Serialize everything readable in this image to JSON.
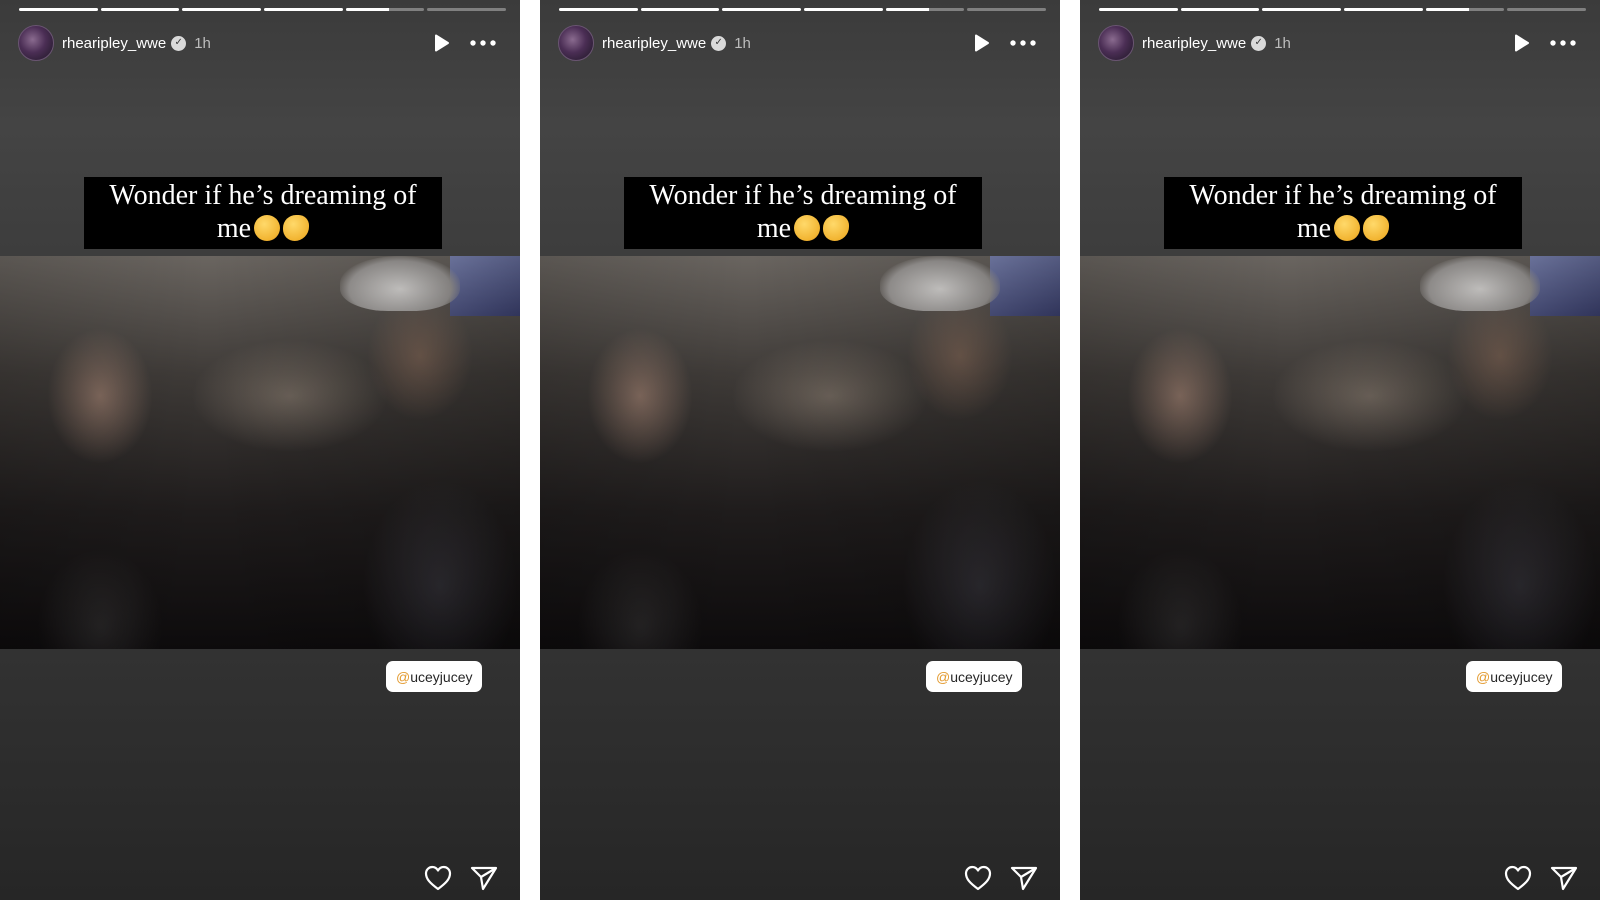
{
  "stories": [
    {
      "progress": [
        1,
        1,
        1,
        1,
        0.55,
        0
      ],
      "username": "rhearipley_wwe",
      "verified_glyph": "✓",
      "time": "1h",
      "caption_line1": "Wonder if he’s dreaming of",
      "caption_line2": "me",
      "mention_prefix": "@",
      "mention_name": "uceyjucey",
      "icons": [
        "play-icon",
        "more-icon",
        "heart-icon",
        "send-icon"
      ]
    },
    {
      "progress": [
        1,
        1,
        1,
        1,
        0.55,
        0
      ],
      "username": "rhearipley_wwe",
      "verified_glyph": "✓",
      "time": "1h",
      "caption_line1": "Wonder if he’s dreaming of",
      "caption_line2": "me",
      "mention_prefix": "@",
      "mention_name": "uceyjucey",
      "icons": [
        "play-icon",
        "more-icon",
        "heart-icon",
        "send-icon"
      ]
    },
    {
      "progress": [
        1,
        1,
        1,
        1,
        0.55,
        0
      ],
      "username": "rhearipley_wwe",
      "verified_glyph": "✓",
      "time": "1h",
      "caption_line1": "Wonder if he’s dreaming of",
      "caption_line2": "me",
      "mention_prefix": "@",
      "mention_name": "uceyjucey",
      "icons": [
        "play-icon",
        "more-icon",
        "heart-icon",
        "send-icon"
      ]
    }
  ],
  "colors": {
    "story_bg": "#3b3b3b",
    "caption_bg": "#000000",
    "mention_bg": "#ffffff",
    "mention_at": "#e39a2e"
  }
}
